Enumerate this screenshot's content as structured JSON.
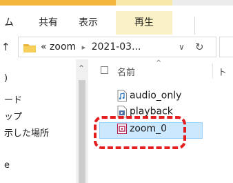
{
  "ribbon": {
    "tab_view_partial": "ム",
    "tab_share": "共有",
    "tab_display": "表示",
    "tab_play": "再生"
  },
  "address_bar": {
    "up_icon": "arrow-up-icon",
    "prefix": "«",
    "crumbs": [
      "zoom",
      "2021-03..."
    ],
    "dropdown_icon": "chevron-down-icon",
    "refresh_icon": "refresh-icon"
  },
  "nav_pane": {
    "items": [
      ")",
      "ード",
      "ップ",
      "示した場所",
      "e"
    ]
  },
  "file_list": {
    "header_name": "名前",
    "header_next": "ト",
    "files": [
      {
        "name": "audio_only",
        "icon": "audio-file-icon"
      },
      {
        "name": "playback",
        "icon": "playlist-file-icon"
      },
      {
        "name": "zoom_0",
        "icon": "video-file-icon",
        "selected": true
      }
    ]
  },
  "colors": {
    "accent": "#f4b63c",
    "selection": "#cce8ff",
    "annotation": "#e41e1e"
  }
}
